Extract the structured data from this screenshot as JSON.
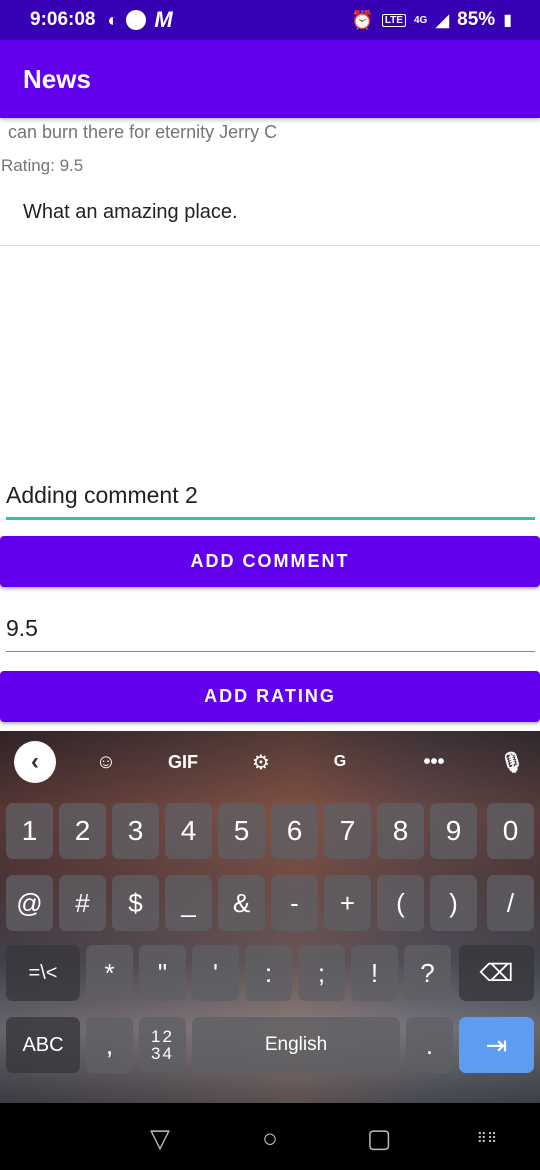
{
  "status_bar": {
    "time": "9:06:08",
    "battery": "85%",
    "network": "4G",
    "icons": [
      "p-icon",
      "circle-icon",
      "m-icon",
      "alarm-icon",
      "volte-icon",
      "signal-icon",
      "battery-icon"
    ]
  },
  "app_bar": {
    "title": "News"
  },
  "comments": {
    "partial_text": "can burn there for eternity Jerry C",
    "rating_line": "Rating: 9.5",
    "comment": "What an amazing place."
  },
  "comment_input": {
    "value": "Adding comment 2"
  },
  "add_comment_button": {
    "label": "ADD COMMENT"
  },
  "rating_input": {
    "value": "9.5"
  },
  "add_rating_button": {
    "label": "ADD RATING"
  },
  "keyboard": {
    "toolbar": {
      "gif_label": "GIF",
      "icons": [
        "back-icon",
        "sticker-icon",
        "gif-icon",
        "settings-icon",
        "translate-icon",
        "more-icon",
        "mic-icon"
      ]
    },
    "row1": [
      "1",
      "2",
      "3",
      "4",
      "5",
      "6",
      "7",
      "8",
      "9",
      "0"
    ],
    "row2": [
      "@",
      "#",
      "$",
      "_",
      "&",
      "-",
      "+",
      "(",
      ")",
      "/"
    ],
    "row3": [
      "=\\<",
      "*",
      "\"",
      "'",
      ":",
      ";",
      "!",
      "?"
    ],
    "row4": {
      "abc": "ABC",
      "comma": ",",
      "numbers_top": "12",
      "numbers_bottom": "34",
      "space": "English",
      "period": "."
    }
  },
  "colors": {
    "primary": "#6200ee",
    "primary_dark": "#3700b3",
    "accent": "#26c6b0",
    "enter_key": "#5c9df2"
  }
}
